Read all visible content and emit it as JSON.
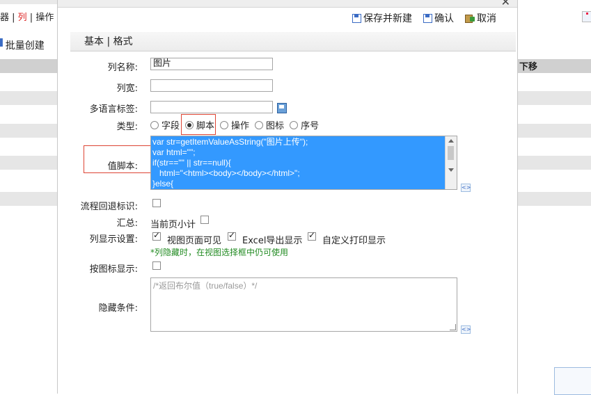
{
  "background": {
    "tabs_fragment": "器 | 列 | 操作",
    "tab_separator_1": "器 | ",
    "tab_active": "列",
    "tab_rest": " | 操作",
    "batch_create": "批量创建",
    "move_down": "下移"
  },
  "toolbar": {
    "save_and_new": "保存并新建",
    "confirm": "确认",
    "cancel": "取消"
  },
  "tabs": {
    "basic": "基本",
    "separator": " | ",
    "format": "格式"
  },
  "form": {
    "column_name": {
      "label": "列名称:",
      "value": "图片"
    },
    "column_width": {
      "label": "列宽:",
      "value": ""
    },
    "i18n_label": {
      "label": "多语言标签:",
      "value": ""
    },
    "type": {
      "label": "类型:",
      "options": [
        "字段",
        "脚本",
        "操作",
        "图标",
        "序号"
      ],
      "selected": "脚本"
    },
    "value_script": {
      "label": "值脚本:",
      "code": "var str=getItemValueAsString(\"图片上传\");\nvar html=\"\";\nif(str==\"\" || str==null){\n   html=\"<html><body></body></html>\";\n}else{"
    },
    "flow_back_flag": {
      "label": "流程回退标识:",
      "checked": false
    },
    "summary": {
      "label": "汇总:",
      "option": "当前页小计",
      "checked": false
    },
    "display_settings": {
      "label": "列显示设置:",
      "options": [
        {
          "text": "视图页面可见",
          "checked": true
        },
        {
          "text": "Excel导出显示",
          "checked": true
        },
        {
          "text": "自定义打印显示",
          "checked": true
        }
      ],
      "hint": "*列隐藏时，在视图选择框中仍可使用"
    },
    "icon_display": {
      "label": "按图标显示:",
      "checked": false
    },
    "hide_condition": {
      "label": "隐藏条件:",
      "placeholder": "/*返回布尔值（true/false）*/"
    }
  }
}
